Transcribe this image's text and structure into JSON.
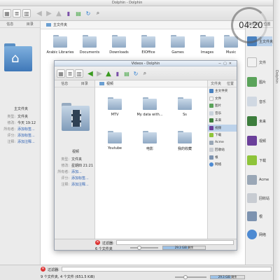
{
  "outer": {
    "title": "Dolphin - Dolphin",
    "left_tabs": [
      "信息",
      "目录"
    ],
    "breadcrumb": "主文件夹",
    "info": {
      "name": "主文件夹",
      "rows": [
        {
          "k": "类型:",
          "v": "文件夹"
        },
        {
          "k": "修改:",
          "v": "今天 19:12"
        },
        {
          "k": "所有者:",
          "v": "添加标签..."
        },
        {
          "k": "评分:",
          "v": "添加标签..."
        },
        {
          "k": "注释:",
          "v": "添加注释..."
        }
      ]
    },
    "folders": [
      "Arabic Libraries",
      "Documents",
      "Downloads",
      "ElOffice",
      "Games",
      "Images",
      "Music"
    ],
    "right_tabs": [
      "文件夹",
      "位置"
    ],
    "places": [
      "主文件夹",
      "文件",
      "图片",
      "音乐",
      "未来",
      "视频",
      "下载",
      "Acme",
      "回收站",
      "根",
      "网络"
    ],
    "status": {
      "filter_label": "过滤器:",
      "summary": "9 个文件夹, 4 个文件 (651.5 KiB)",
      "free": "29.3 GiB 剩余"
    }
  },
  "clock": {
    "time": "04:20"
  },
  "inner": {
    "title": "Videos - Dolphin",
    "left_tabs": [
      "信息",
      "目录"
    ],
    "breadcrumb": "视频",
    "info": {
      "name": "视频",
      "rows": [
        {
          "k": "类型:",
          "v": "文件夹"
        },
        {
          "k": "修改:",
          "v": "星期四 21:21"
        },
        {
          "k": "所有者:",
          "v": "添加..."
        },
        {
          "k": "评分:",
          "v": "添加标签..."
        },
        {
          "k": "注释:",
          "v": "添加注释..."
        }
      ]
    },
    "folders": [
      "MTV",
      "My data with...",
      "Ss",
      "Youtube",
      "电影",
      "我的收藏"
    ],
    "right_tabs": [
      "文件夹",
      "位置"
    ],
    "places": [
      "主文件夹",
      "文件",
      "图片",
      "音乐",
      "未来",
      "视频",
      "下载",
      "Acme",
      "回收站",
      "根",
      "网络"
    ],
    "status": {
      "filter_label": "过滤器:",
      "summary": "6 个文件夹",
      "free": "29.3 GiB 剩余"
    }
  },
  "scroll_strip": {
    "label": "Dolphin"
  }
}
